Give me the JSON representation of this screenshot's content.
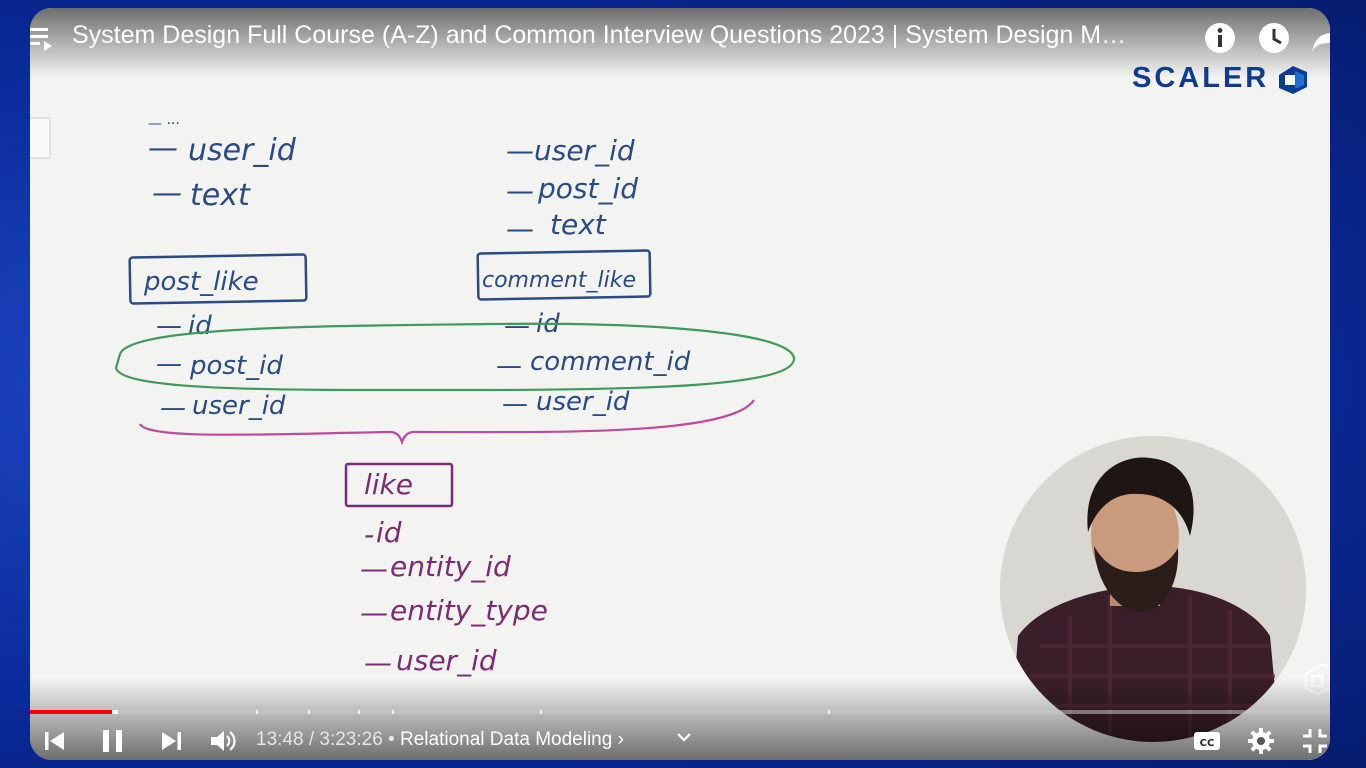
{
  "video": {
    "title": "System Design Full Course (A-Z) and Common Interview Questions 2023 | System Design M…",
    "current_time": "13:48",
    "duration": "3:23:26",
    "chapter": "Relational Data Modeling",
    "progress_fraction": 0.067
  },
  "brand": {
    "logo_text": "SCALER",
    "color": "#0b3c91"
  },
  "whiteboard": {
    "left_column_top": [
      "user_id",
      "text"
    ],
    "right_column_top": [
      "user_id",
      "post_id",
      "text"
    ],
    "post_like": {
      "title": "post_like",
      "fields": [
        "id",
        "post_id",
        "user_id"
      ]
    },
    "comment_like": {
      "title": "comment_like",
      "fields": [
        "id",
        "comment_id",
        "user_id"
      ]
    },
    "like": {
      "title": "like",
      "fields": [
        "id",
        "entity_id",
        "entity_type",
        "user_id"
      ]
    }
  },
  "icons": {
    "menu": "playlist-icon",
    "info": "info-icon",
    "watch_later": "clock-icon",
    "share": "share-icon",
    "prev": "previous-icon",
    "pause": "pause-icon",
    "next": "next-icon",
    "volume": "volume-icon",
    "chapter_chevron": "chevron-down-icon",
    "captions": "captions-icon",
    "settings": "gear-icon",
    "exit_fullscreen": "exit-fullscreen-icon"
  },
  "colors": {
    "ink_blue": "#2a4a86",
    "ink_purple": "#7d2c73",
    "highlight_green": "#3f9a5b",
    "brace_pink": "#c04aa0",
    "progress_red": "#ff0000"
  }
}
